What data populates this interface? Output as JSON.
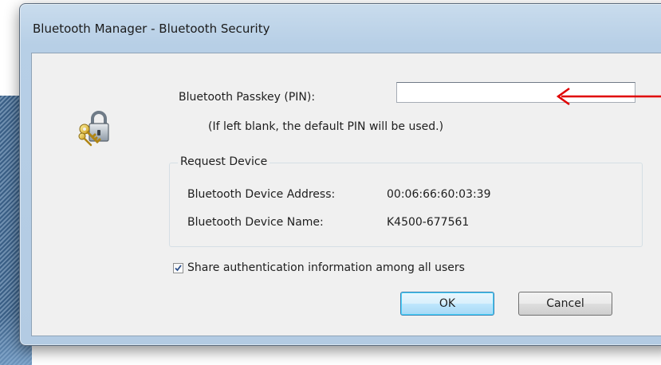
{
  "window": {
    "title": "Bluetooth Manager - Bluetooth Security"
  },
  "icon": {
    "name": "lock-with-key-icon"
  },
  "passkey": {
    "label": "Bluetooth Passkey (PIN):",
    "value": "",
    "placeholder": "",
    "hint": "(If left blank, the default PIN will be used.)"
  },
  "request_device": {
    "group_label": "Request Device",
    "address_label": "Bluetooth Device Address:",
    "address_value": "00:06:66:60:03:39",
    "name_label": "Bluetooth Device Name:",
    "name_value": "K4500-677561"
  },
  "share": {
    "label": "Share authentication information among all users",
    "checked": true
  },
  "buttons": {
    "ok": "OK",
    "cancel": "Cancel"
  },
  "colors": {
    "annotation_arrow": "#e00000",
    "ok_border": "#3c7fb1",
    "frame": "#b7cfe6"
  }
}
